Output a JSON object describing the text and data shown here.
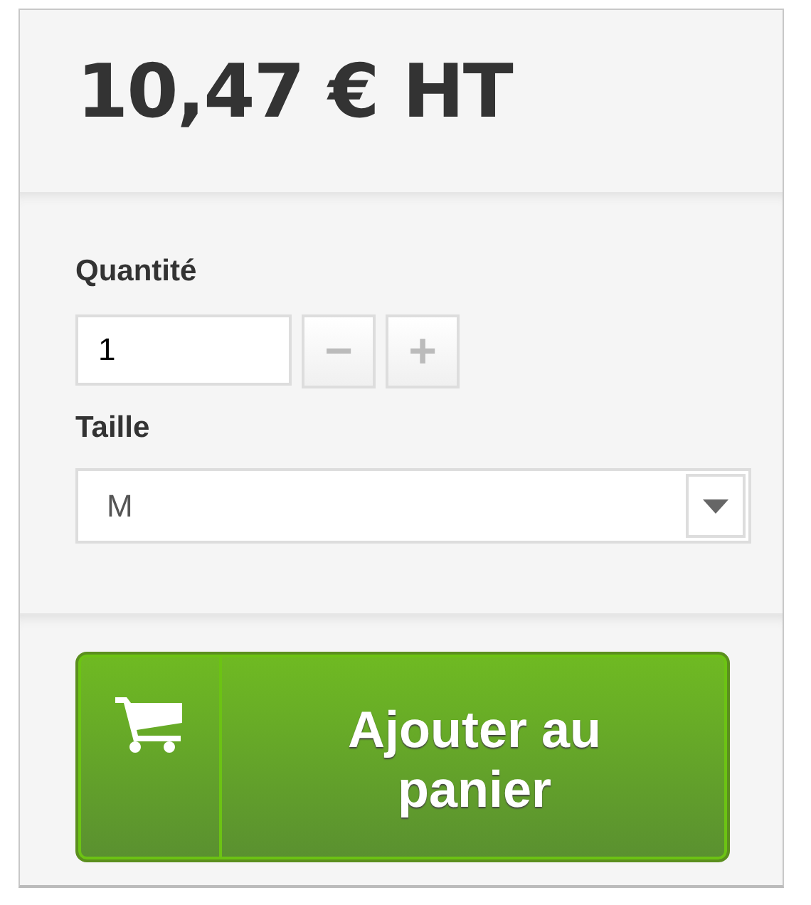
{
  "price": "10,47 € HT",
  "quantity": {
    "label": "Quantité",
    "value": "1",
    "minus": "−",
    "plus": "+"
  },
  "size": {
    "label": "Taille",
    "value": "M"
  },
  "add_button": {
    "label": "Ajouter au panier"
  }
}
